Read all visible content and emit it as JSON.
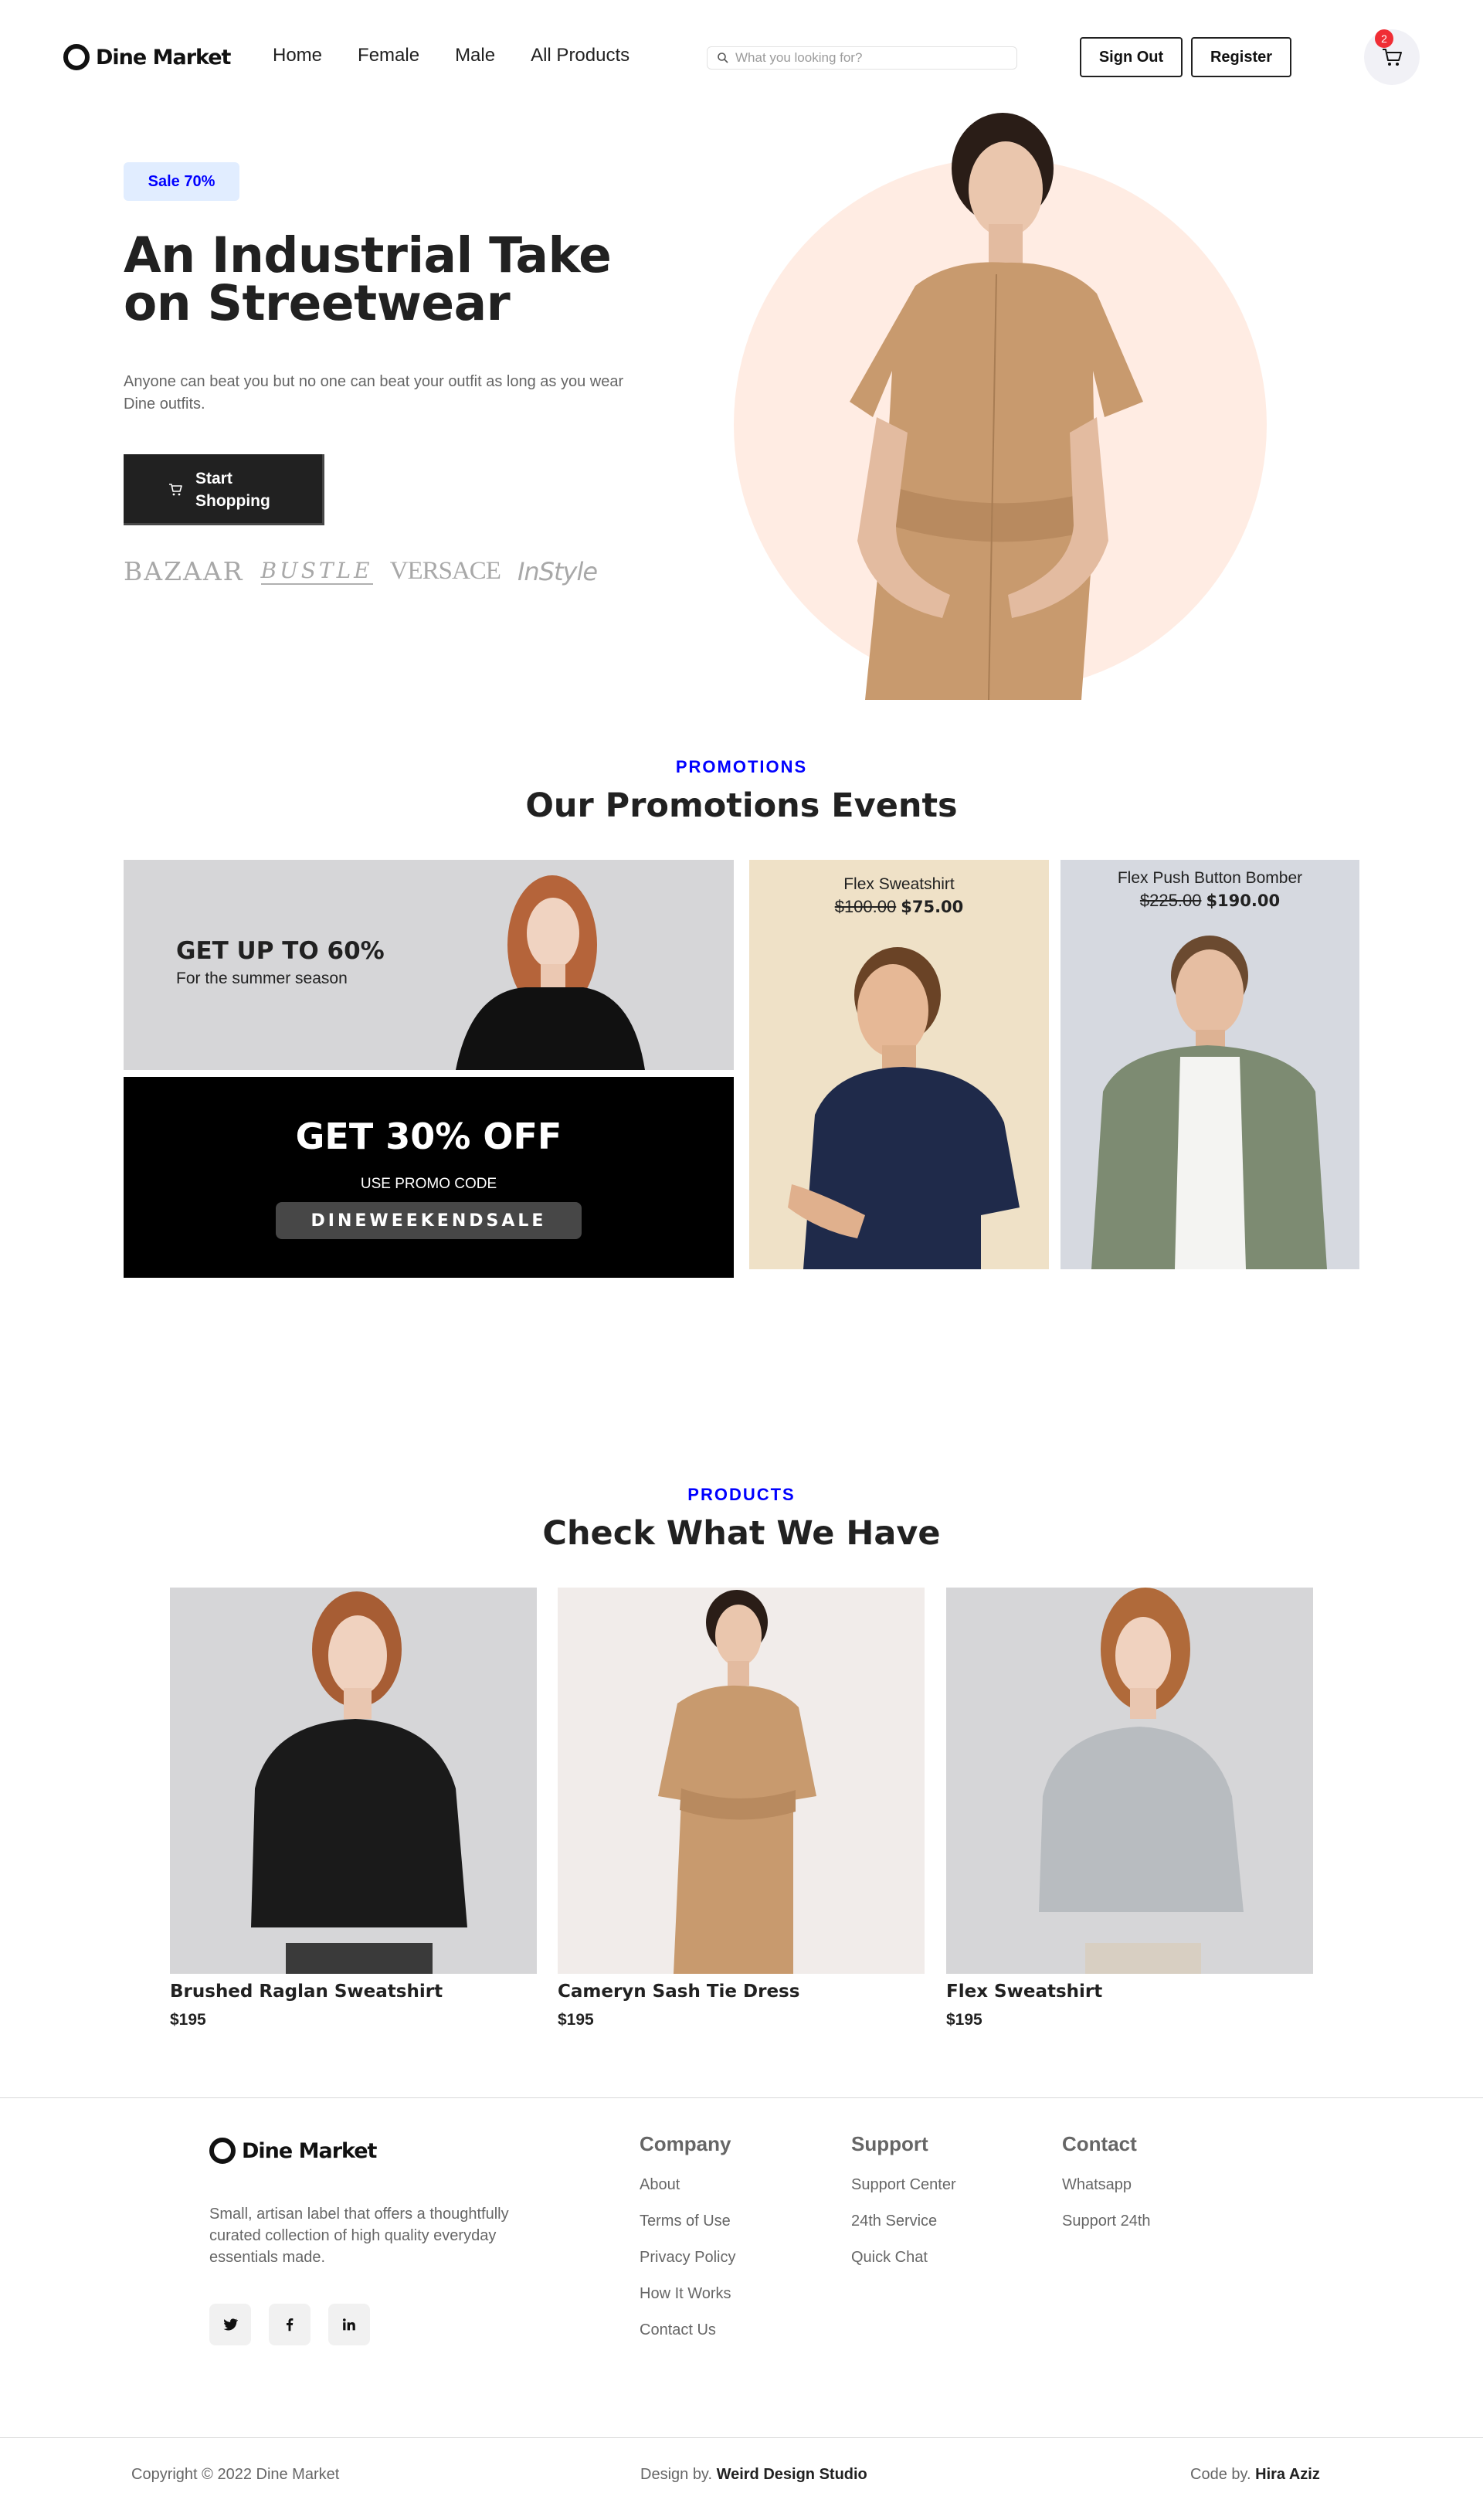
{
  "brand": {
    "name": "Dine Market"
  },
  "nav": {
    "links": [
      "Home",
      "Female",
      "Male",
      "All Products"
    ],
    "search_placeholder": "What you looking for?",
    "signout_label": "Sign Out",
    "register_label": "Register",
    "cart_count": "2"
  },
  "hero": {
    "badge": "Sale 70%",
    "title_line1": "An Industrial Take",
    "title_line2": "on Streetwear",
    "description": "Anyone can beat you but no one can beat your outfit as long as you wear Dine outfits.",
    "cta_line1": "Start",
    "cta_line2": "Shopping",
    "brands": [
      "BAZAAR",
      "BUSTLE",
      "VERSACE",
      "InStyle"
    ]
  },
  "promotions": {
    "kicker": "PROMOTIONS",
    "title": "Our Promotions Events",
    "card1": {
      "title": "GET UP TO 60%",
      "subtitle": "For the summer season"
    },
    "card2": {
      "title": "GET 30% OFF",
      "subtitle": "USE PROMO CODE",
      "code": "DINEWEEKENDSALE"
    },
    "card3": {
      "name": "Flex Sweatshirt",
      "old_price": "$100.00",
      "price": "$75.00"
    },
    "card4": {
      "name": "Flex Push Button Bomber",
      "old_price": "$225.00",
      "price": "$190.00"
    }
  },
  "products": {
    "kicker": "PRODUCTS",
    "title": "Check What We Have",
    "items": [
      {
        "name": "Brushed Raglan Sweatshirt",
        "price": "$195"
      },
      {
        "name": "Cameryn Sash Tie Dress",
        "price": "$195"
      },
      {
        "name": "Flex Sweatshirt",
        "price": "$195"
      }
    ]
  },
  "footer": {
    "description": "Small, artisan label that offers a thoughtfully curated collection of high quality everyday essentials made.",
    "columns": [
      {
        "title": "Company",
        "links": [
          "About",
          "Terms of Use",
          "Privacy Policy",
          "How It Works",
          "Contact Us"
        ]
      },
      {
        "title": "Support",
        "links": [
          "Support Center",
          "24th Service",
          "Quick Chat"
        ]
      },
      {
        "title": "Contact",
        "links": [
          "Whatsapp",
          "Support 24th"
        ]
      }
    ],
    "copyright": "Copyright © 2022 Dine Market",
    "design_prefix": "Design by.",
    "design_by": "Weird Design Studio",
    "code_prefix": "Code by.",
    "code_by": "Hira Aziz"
  },
  "colors": {
    "accent": "#0000ff",
    "dark": "#212121",
    "badge_bg": "#e1edff",
    "hero_circle": "#ffece3",
    "cart_badge": "#f02d34"
  }
}
